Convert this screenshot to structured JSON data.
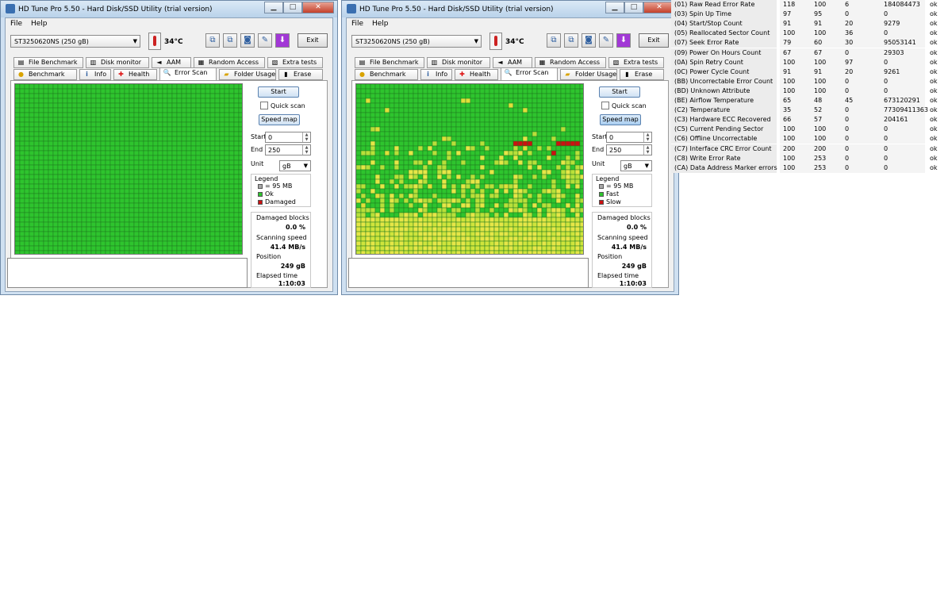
{
  "windows": [
    {
      "id": "w1",
      "title": "HD Tune Pro 5.50 - Hard Disk/SSD Utility (trial version)",
      "menu": [
        "File",
        "Help"
      ],
      "drive": "ST3250620NS (250 gB)",
      "temperature": "34°C",
      "exit_label": "Exit",
      "tabs_row1": [
        "File Benchmark",
        "Disk monitor",
        "AAM",
        "Random Access",
        "Extra tests"
      ],
      "tabs_row2": [
        "Benchmark",
        "Info",
        "Health",
        "Error Scan",
        "Folder Usage",
        "Erase"
      ],
      "active_tab": "Error Scan",
      "start_button": "Start",
      "quick_scan_label": "Quick scan",
      "quick_scan_checked": false,
      "speed_map_label": "Speed map",
      "speed_map_active": false,
      "start_label": "Start",
      "start_value": "0",
      "end_label": "End",
      "end_value": "250",
      "unit_label": "Unit",
      "unit_value": "gB",
      "legend": {
        "title": "Legend",
        "block": "= 95 MB",
        "ok": "Ok",
        "bad": "Damaged"
      },
      "damaged_blocks_label": "Damaged blocks",
      "damaged_blocks_value": "0.0 %",
      "scanning_speed_label": "Scanning speed",
      "scanning_speed_value": "41.4 MB/s",
      "position_label": "Position",
      "position_value": "249 gB",
      "elapsed_label": "Elapsed time",
      "elapsed_value": "1:10:03",
      "grid_mode": "errors"
    },
    {
      "id": "w2",
      "title": "HD Tune Pro 5.50 - Hard Disk/SSD Utility (trial version)",
      "menu": [
        "File",
        "Help"
      ],
      "drive": "ST3250620NS (250 gB)",
      "temperature": "34°C",
      "exit_label": "Exit",
      "tabs_row1": [
        "File Benchmark",
        "Disk monitor",
        "AAM",
        "Random Access",
        "Extra tests"
      ],
      "tabs_row2": [
        "Benchmark",
        "Info",
        "Health",
        "Error Scan",
        "Folder Usage",
        "Erase"
      ],
      "active_tab": "Error Scan",
      "start_button": "Start",
      "quick_scan_label": "Quick scan",
      "quick_scan_checked": false,
      "speed_map_label": "Speed map",
      "speed_map_active": true,
      "start_label": "Start",
      "start_value": "0",
      "end_label": "End",
      "end_value": "250",
      "unit_label": "Unit",
      "unit_value": "gB",
      "legend": {
        "title": "Legend",
        "block": "= 95 MB",
        "ok": "Fast",
        "bad": "Slow"
      },
      "damaged_blocks_label": "Damaged blocks",
      "damaged_blocks_value": "0.0 %",
      "scanning_speed_label": "Scanning speed",
      "scanning_speed_value": "41.4 MB/s",
      "position_label": "Position",
      "position_value": "249 gB",
      "elapsed_label": "Elapsed time",
      "elapsed_value": "1:10:03",
      "grid_mode": "speed"
    }
  ],
  "colors": {
    "ok_green": "#2ec42e",
    "damaged_red": "#cc1111",
    "slow_yellow": "#e6e647",
    "grid_line": "#1e7a1e",
    "title_bar": "#bcd4ec"
  },
  "icons": {
    "toolbar": [
      "copy-info-icon",
      "copy-info-all-icon",
      "screenshot-icon",
      "options-icon",
      "download-icon"
    ],
    "tabs_row1": [
      "file-benchmark-icon",
      "disk-monitor-icon",
      "speaker-icon",
      "random-access-icon",
      "extra-tests-icon"
    ],
    "tabs_row2": [
      "benchmark-icon",
      "info-icon",
      "health-cross-icon",
      "magnifier-icon",
      "folder-icon",
      "erase-icon"
    ]
  },
  "smart": [
    {
      "name": "(01) Raw Read Error Rate",
      "current": "118",
      "worst": "100",
      "threshold": "6",
      "data": "184084473",
      "status": "ok"
    },
    {
      "name": "(03) Spin Up Time",
      "current": "97",
      "worst": "95",
      "threshold": "0",
      "data": "0",
      "status": "ok"
    },
    {
      "name": "(04) Start/Stop Count",
      "current": "91",
      "worst": "91",
      "threshold": "20",
      "data": "9279",
      "status": "ok"
    },
    {
      "name": "(05) Reallocated Sector Count",
      "current": "100",
      "worst": "100",
      "threshold": "36",
      "data": "0",
      "status": "ok"
    },
    {
      "name": "(07) Seek Error Rate",
      "current": "79",
      "worst": "60",
      "threshold": "30",
      "data": "95053141",
      "status": "ok"
    },
    {
      "name": "(09) Power On Hours Count",
      "current": "67",
      "worst": "67",
      "threshold": "0",
      "data": "29303",
      "status": "ok"
    },
    {
      "name": "(0A) Spin Retry Count",
      "current": "100",
      "worst": "100",
      "threshold": "97",
      "data": "0",
      "status": "ok"
    },
    {
      "name": "(0C) Power Cycle Count",
      "current": "91",
      "worst": "91",
      "threshold": "20",
      "data": "9261",
      "status": "ok"
    },
    {
      "name": "(BB) Uncorrectable Error Count",
      "current": "100",
      "worst": "100",
      "threshold": "0",
      "data": "0",
      "status": "ok"
    },
    {
      "name": "(BD) Unknown Attribute",
      "current": "100",
      "worst": "100",
      "threshold": "0",
      "data": "0",
      "status": "ok"
    },
    {
      "name": "(BE) Airflow Temperature",
      "current": "65",
      "worst": "48",
      "threshold": "45",
      "data": "673120291",
      "status": "ok"
    },
    {
      "name": "(C2) Temperature",
      "current": "35",
      "worst": "52",
      "threshold": "0",
      "data": "77309411363",
      "status": "ok"
    },
    {
      "name": "(C3) Hardware ECC Recovered",
      "current": "66",
      "worst": "57",
      "threshold": "0",
      "data": "204161",
      "status": "ok"
    },
    {
      "name": "(C5) Current Pending Sector",
      "current": "100",
      "worst": "100",
      "threshold": "0",
      "data": "0",
      "status": "ok"
    },
    {
      "name": "(C6) Offline Uncorrectable",
      "current": "100",
      "worst": "100",
      "threshold": "0",
      "data": "0",
      "status": "ok"
    },
    {
      "name": "(C7) Interface CRC Error Count",
      "current": "200",
      "worst": "200",
      "threshold": "0",
      "data": "0",
      "status": "ok"
    },
    {
      "name": "(C8) Write Error Rate",
      "current": "100",
      "worst": "253",
      "threshold": "0",
      "data": "0",
      "status": "ok"
    },
    {
      "name": "(CA) Data Address Marker errors",
      "current": "100",
      "worst": "253",
      "threshold": "0",
      "data": "0",
      "status": "ok"
    }
  ]
}
